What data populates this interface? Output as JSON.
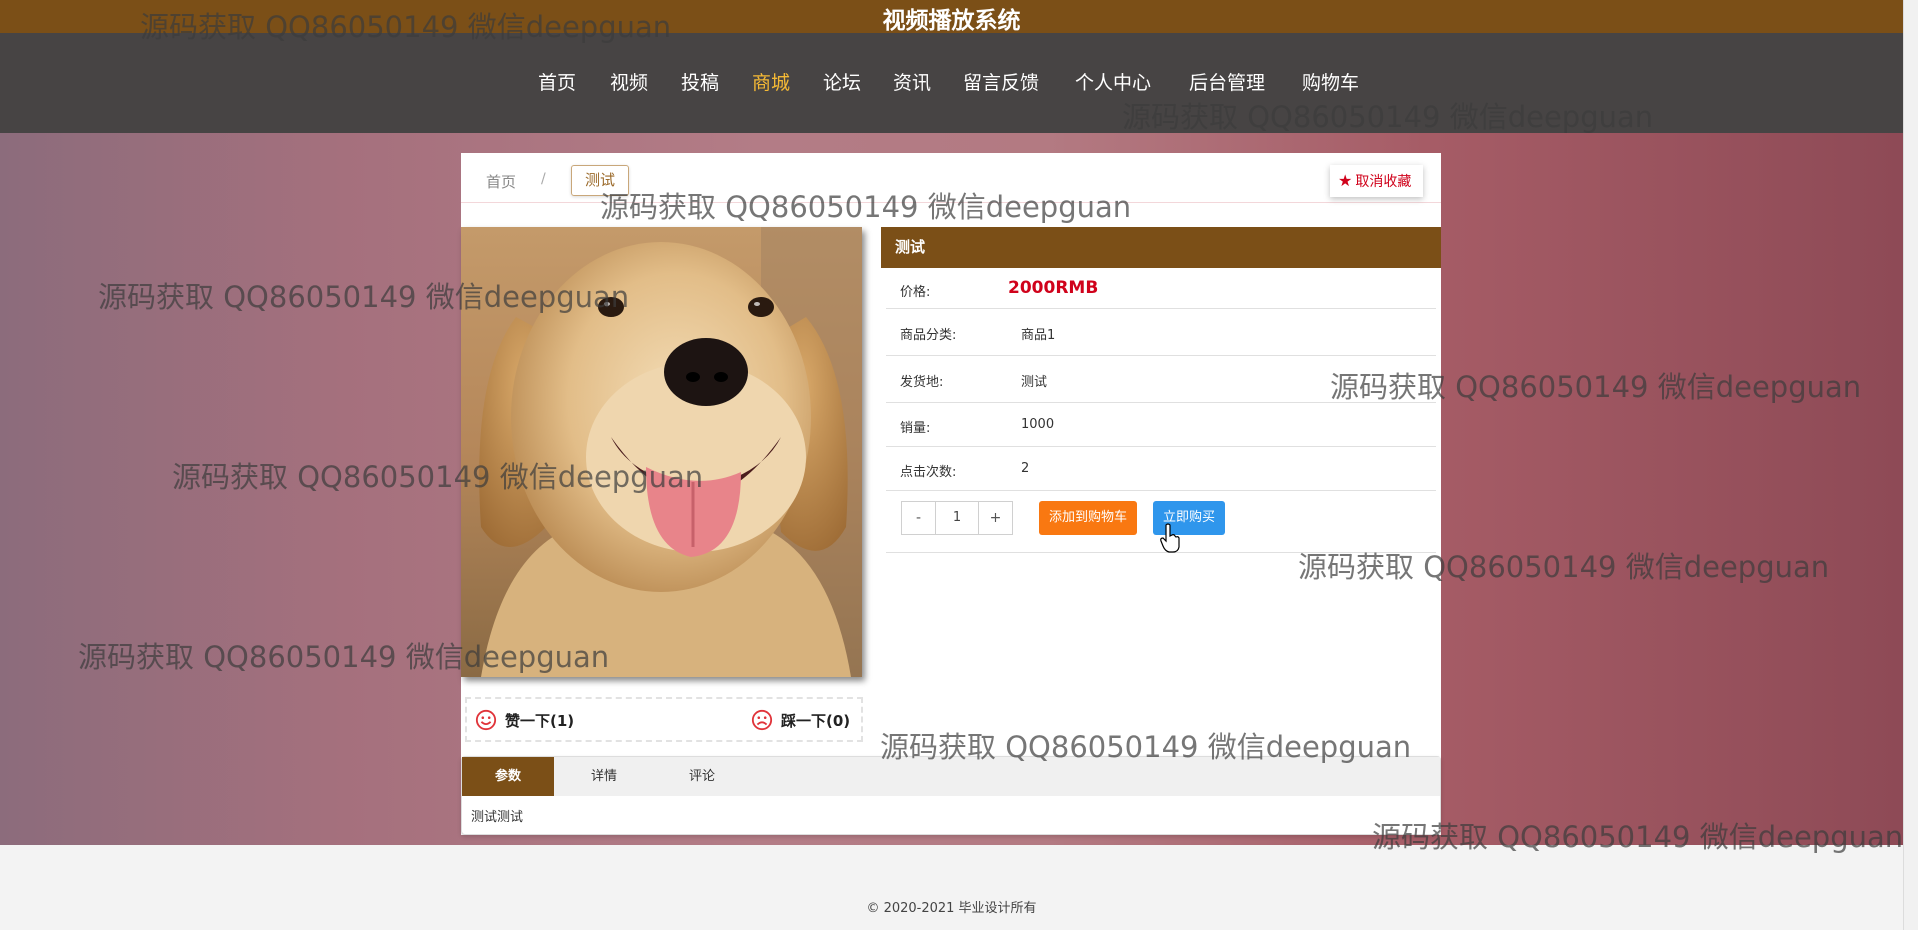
{
  "header": {
    "title": "视频播放系统"
  },
  "nav": {
    "items": [
      {
        "label": "首页"
      },
      {
        "label": "视频"
      },
      {
        "label": "投稿"
      },
      {
        "label": "商城",
        "active": true
      },
      {
        "label": "论坛"
      },
      {
        "label": "资讯"
      },
      {
        "label": "留言反馈"
      },
      {
        "label": "个人中心"
      },
      {
        "label": "后台管理"
      },
      {
        "label": "购物车"
      }
    ]
  },
  "breadcrumb": {
    "home": "首页",
    "separator": "/",
    "current": "测试"
  },
  "favorite": {
    "label": "取消收藏",
    "icon": "star-icon"
  },
  "product": {
    "name": "测试",
    "fields": [
      {
        "label": "价格:",
        "value": "2000RMB"
      },
      {
        "label": "商品分类:",
        "value": "商品1"
      },
      {
        "label": "发货地:",
        "value": "测试"
      },
      {
        "label": "销量:",
        "value": "1000"
      },
      {
        "label": "点击次数:",
        "value": "2"
      }
    ],
    "image_alt": "dog-photo"
  },
  "quantity": {
    "minus": "-",
    "value": "1",
    "plus": "+"
  },
  "actions": {
    "add_to_cart": "添加到购物车",
    "buy_now": "立即购买"
  },
  "votes": {
    "like": "赞一下(1)",
    "dislike": "踩一下(0)"
  },
  "tabs": {
    "items": [
      {
        "label": "参数",
        "active": true
      },
      {
        "label": "详情"
      },
      {
        "label": "评论"
      }
    ],
    "content": "测试测试"
  },
  "footer": {
    "copyright": "© 2020-2021 毕业设计所有"
  },
  "watermark": {
    "text": "源码获取 QQ86050149 微信deepguan"
  },
  "colors": {
    "brand": "#7b4f17",
    "nav_bg": "#474444",
    "active_nav": "#f4b935",
    "price": "#d0021b",
    "cart_btn": "#f97811",
    "buy_btn": "#2f96ec"
  }
}
